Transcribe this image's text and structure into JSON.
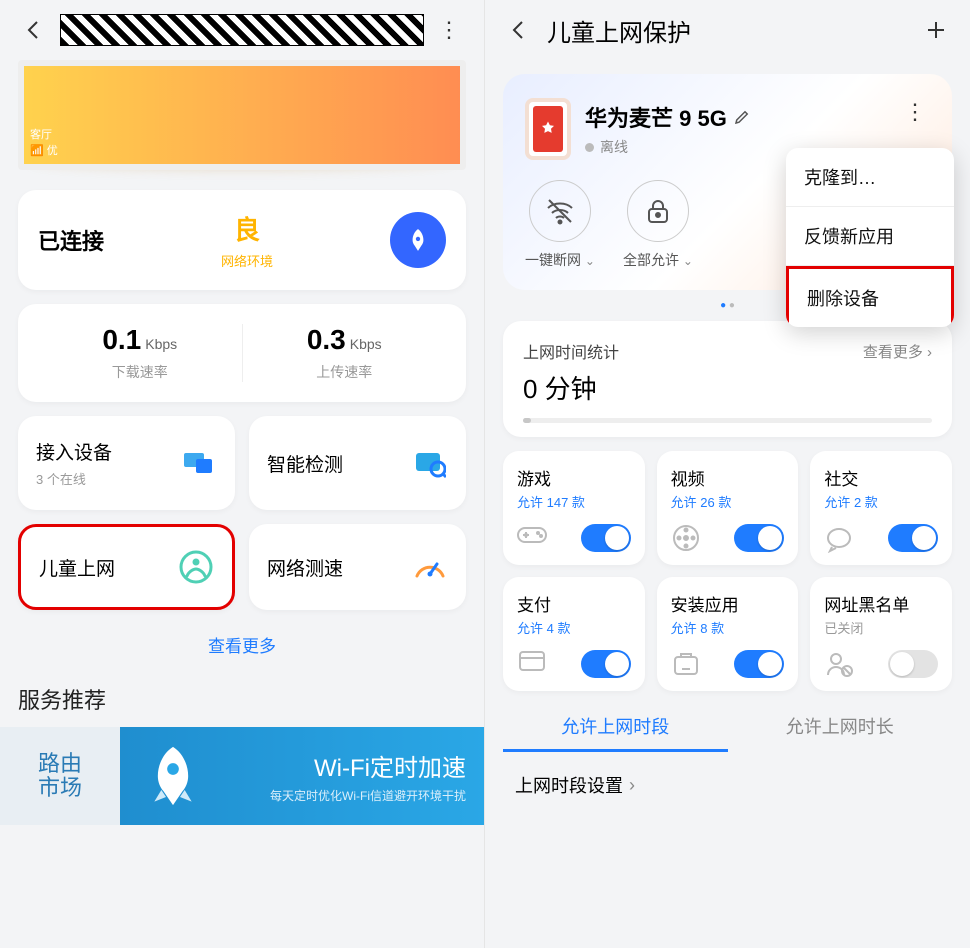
{
  "left": {
    "banner": {
      "room": "客厅",
      "signal": "优"
    },
    "status": {
      "connected": "已连接",
      "quality": "良",
      "quality_label": "网络环境"
    },
    "speed": {
      "down_val": "0.1",
      "down_unit": "Kbps",
      "down_label": "下载速率",
      "up_val": "0.3",
      "up_unit": "Kbps",
      "up_label": "上传速率"
    },
    "tiles": {
      "devices": {
        "title": "接入设备",
        "sub": "3 个在线"
      },
      "diagnose": {
        "title": "智能检测"
      },
      "parental": {
        "title": "儿童上网"
      },
      "speedtest": {
        "title": "网络测速"
      }
    },
    "see_more": "查看更多",
    "service": {
      "heading": "服务推荐",
      "market1": "路由",
      "market2": "市场",
      "promo_title": "Wi-Fi定时加速",
      "promo_sub": "每天定时优化Wi-Fi信道避开环境干扰"
    }
  },
  "right": {
    "title": "儿童上网保护",
    "device": {
      "name": "华为麦芒 9 5G",
      "status": "离线"
    },
    "actions": {
      "disconnect": "一键断网",
      "allow_all": "全部允许"
    },
    "popup": {
      "clone": "克隆到…",
      "feedback": "反馈新应用",
      "delete": "删除设备"
    },
    "stats": {
      "label": "上网时间统计",
      "more": "查看更多",
      "value": "0 分钟"
    },
    "cats": [
      {
        "title": "游戏",
        "sub": "允许 147 款",
        "on": true
      },
      {
        "title": "视频",
        "sub": "允许 26 款",
        "on": true
      },
      {
        "title": "社交",
        "sub": "允许 2 款",
        "on": true
      },
      {
        "title": "支付",
        "sub": "允许 4 款",
        "on": true
      },
      {
        "title": "安装应用",
        "sub": "允许 8 款",
        "on": true
      },
      {
        "title": "网址黑名单",
        "sub": "已关闭",
        "on": false
      }
    ],
    "tabs": {
      "period": "允许上网时段",
      "duration": "允许上网时长"
    },
    "period_setting": "上网时段设置"
  }
}
